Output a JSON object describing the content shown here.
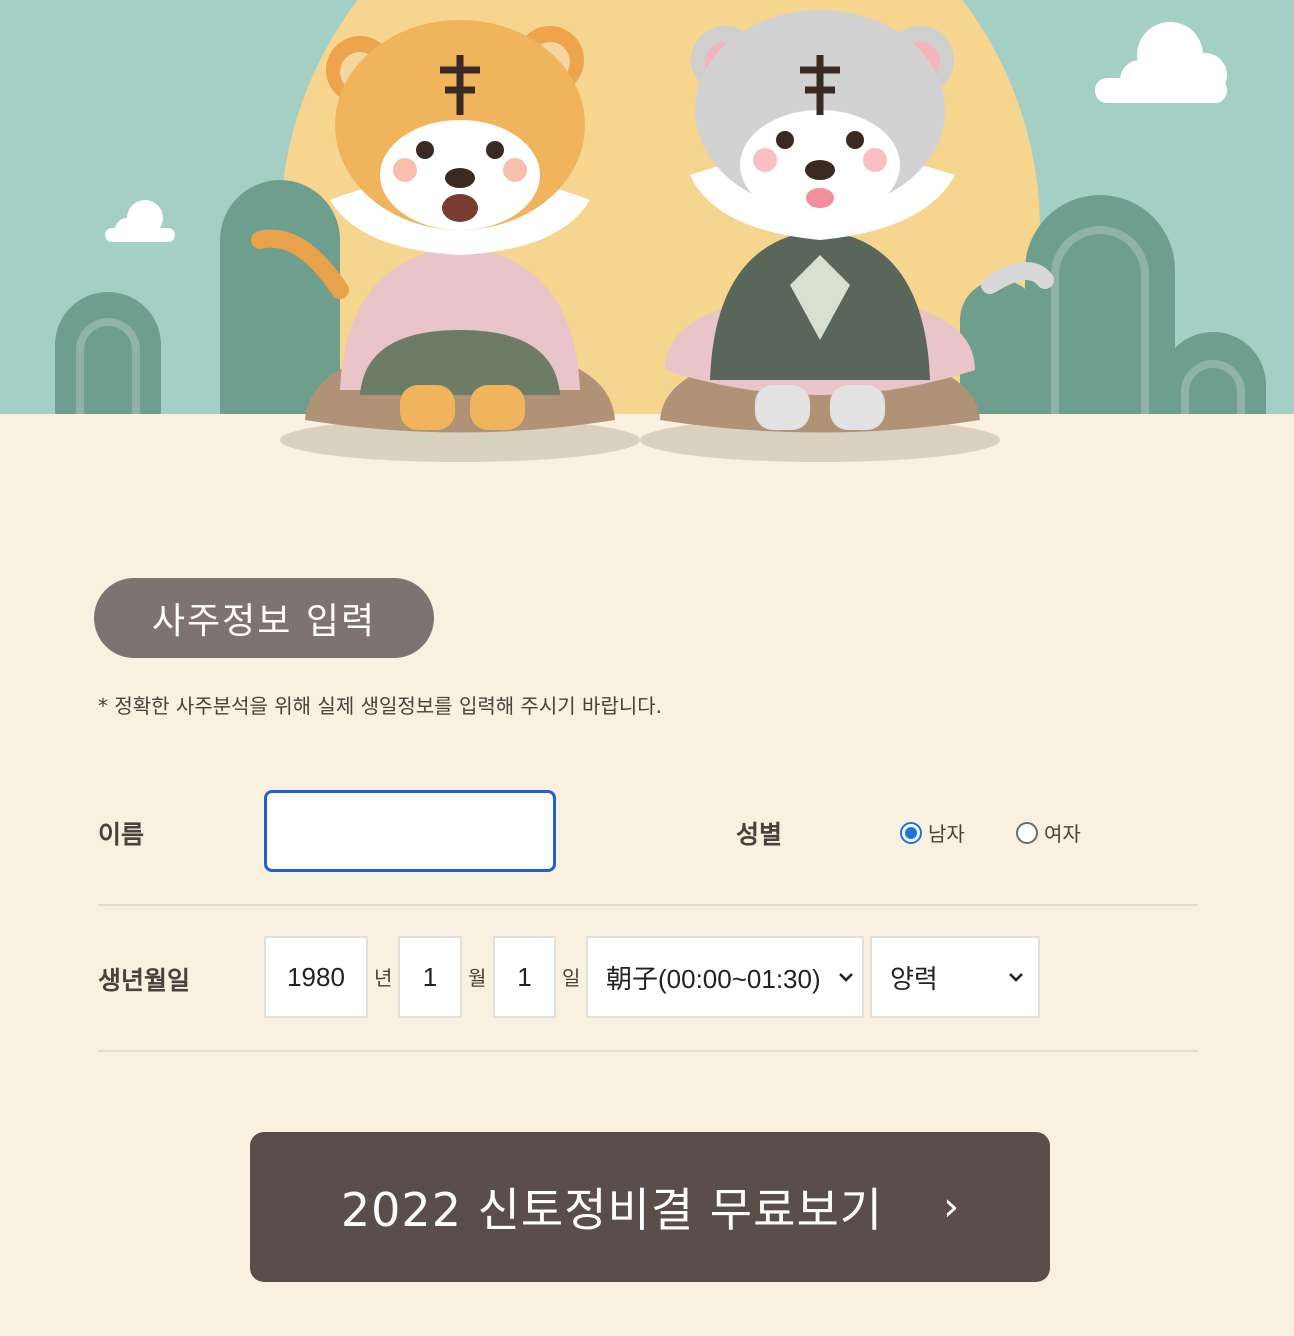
{
  "hero": {
    "sky_color": "#a3cfc4",
    "sun_color": "#f6d58f",
    "ground_color": "#f9f0df"
  },
  "form": {
    "section_title": "사주정보 입력",
    "notice": "* 정확한 사주분석을 위해 실제 생일정보를 입력해 주시기 바랍니다.",
    "name": {
      "label": "이름",
      "value": ""
    },
    "gender": {
      "label": "성별",
      "options": [
        {
          "label": "남자",
          "checked": true
        },
        {
          "label": "여자",
          "checked": false
        }
      ]
    },
    "birth": {
      "label": "생년월일",
      "year": "1980",
      "year_unit": "년",
      "month": "1",
      "month_unit": "월",
      "day": "1",
      "day_unit": "일",
      "time": "朝子(00:00~01:30)",
      "calendar": "양력"
    }
  },
  "cta": {
    "label": "2022 신토정비결 무료보기",
    "arrow": "›",
    "color": "#5b4d4a"
  }
}
